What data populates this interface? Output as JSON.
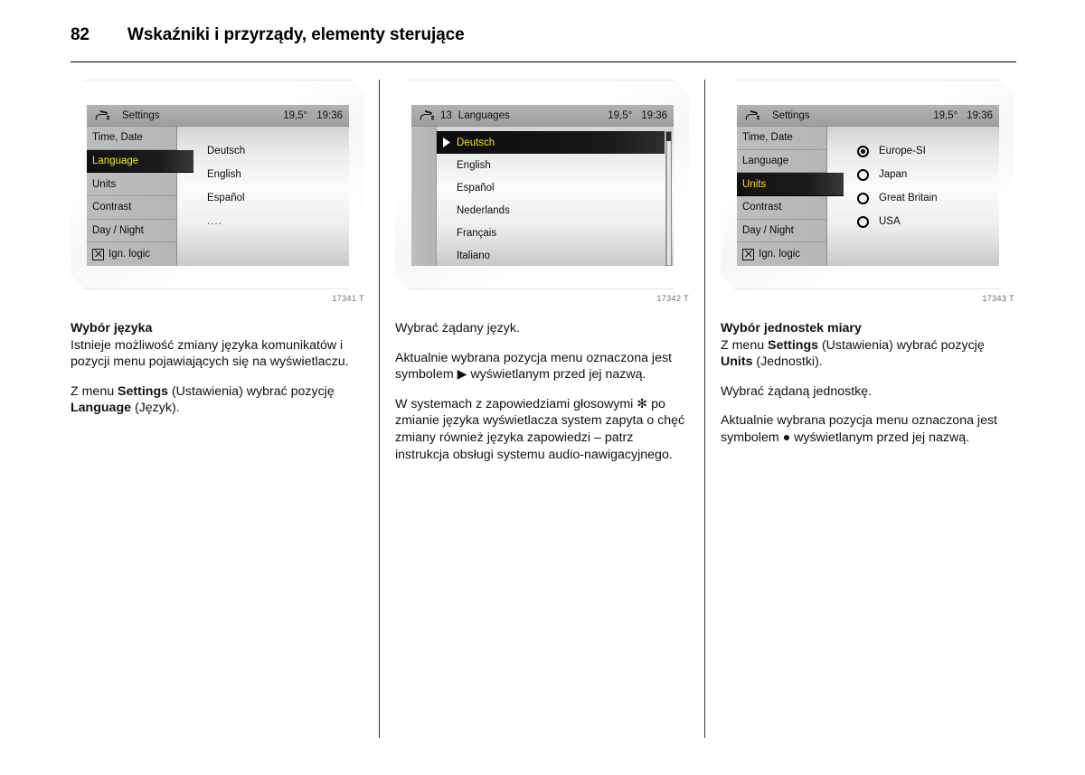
{
  "page": {
    "number": "82",
    "title": "Wskaźniki i przyrządy, elementy sterujące"
  },
  "figures": [
    {
      "caption": "17341 T",
      "status_bar": {
        "icon": "settings-tool-icon",
        "index": "",
        "title": "Settings",
        "temperature": "19,5°",
        "clock": "19:36"
      },
      "menu_items": [
        {
          "label": "Time, Date",
          "selected": false,
          "checkbox": false
        },
        {
          "label": "Language",
          "selected": true,
          "checkbox": false
        },
        {
          "label": "Units",
          "selected": false,
          "checkbox": false
        },
        {
          "label": "Contrast",
          "selected": false,
          "checkbox": false
        },
        {
          "label": "Day / Night",
          "selected": false,
          "checkbox": false
        },
        {
          "label": "Ign. logic",
          "selected": false,
          "checkbox": true
        }
      ],
      "values": [
        "Deutsch",
        "English",
        "Español",
        "...."
      ]
    },
    {
      "caption": "17342 T",
      "status_bar": {
        "icon": "settings-tool-icon",
        "index": "13",
        "title": "Languages",
        "temperature": "19,5°",
        "clock": "19:36"
      },
      "languages": [
        {
          "label": "Deutsch",
          "selected": true
        },
        {
          "label": "English",
          "selected": false
        },
        {
          "label": "Español",
          "selected": false
        },
        {
          "label": "Nederlands",
          "selected": false
        },
        {
          "label": "Français",
          "selected": false
        },
        {
          "label": "Italiano",
          "selected": false
        }
      ]
    },
    {
      "caption": "17343 T",
      "status_bar": {
        "icon": "settings-tool-icon",
        "index": "",
        "title": "Settings",
        "temperature": "19,5°",
        "clock": "19:36"
      },
      "menu_items": [
        {
          "label": "Time, Date",
          "selected": false,
          "checkbox": false
        },
        {
          "label": "Language",
          "selected": false,
          "checkbox": false
        },
        {
          "label": "Units",
          "selected": true,
          "checkbox": false
        },
        {
          "label": "Contrast",
          "selected": false,
          "checkbox": false
        },
        {
          "label": "Day / Night",
          "selected": false,
          "checkbox": false
        },
        {
          "label": "Ign. logic",
          "selected": false,
          "checkbox": true
        }
      ],
      "units": [
        {
          "label": "Europe-SI",
          "selected": true
        },
        {
          "label": "Japan",
          "selected": false
        },
        {
          "label": "Great Britain",
          "selected": false
        },
        {
          "label": "USA",
          "selected": false
        }
      ]
    }
  ],
  "columns": {
    "c1": {
      "heading": "Wybór języka",
      "p1": "Istnieje możliwość zmiany języka komunikatów i pozycji menu pojawiających się na wyświetlaczu.",
      "p2_a": "Z menu ",
      "p2_b": "Settings",
      "p2_c": " (Ustawienia) wybrać pozycję ",
      "p2_d": "Language",
      "p2_e": " (Język)."
    },
    "c2": {
      "p1": "Wybrać żądany język.",
      "p2": "Aktualnie wybrana pozycja menu oznaczona jest symbolem ▶ wyświetlanym przed jej nazwą.",
      "p3": "W systemach z zapowiedziami głosowymi ✻ po zmianie języka wyświetlacza system zapyta o chęć zmiany również języka zapowiedzi – patrz instrukcja obsługi systemu audio-nawigacyjnego."
    },
    "c3": {
      "heading": "Wybór jednostek miary",
      "p1_a": "Z menu ",
      "p1_b": "Settings",
      "p1_c": " (Ustawienia) wybrać pozycję ",
      "p1_d": "Units",
      "p1_e": " (Jednostki).",
      "p2": "Wybrać żądaną jednostkę.",
      "p3": "Aktualnie wybrana pozycja menu oznaczona jest symbolem ● wyświetlanym przed jej nazwą."
    }
  },
  "colors": {
    "highlight_bg": "#111111",
    "highlight_text": "#f2e21a",
    "status_bar_bg": "#a8a8a8",
    "menu_bg": "#b8b8b8"
  }
}
